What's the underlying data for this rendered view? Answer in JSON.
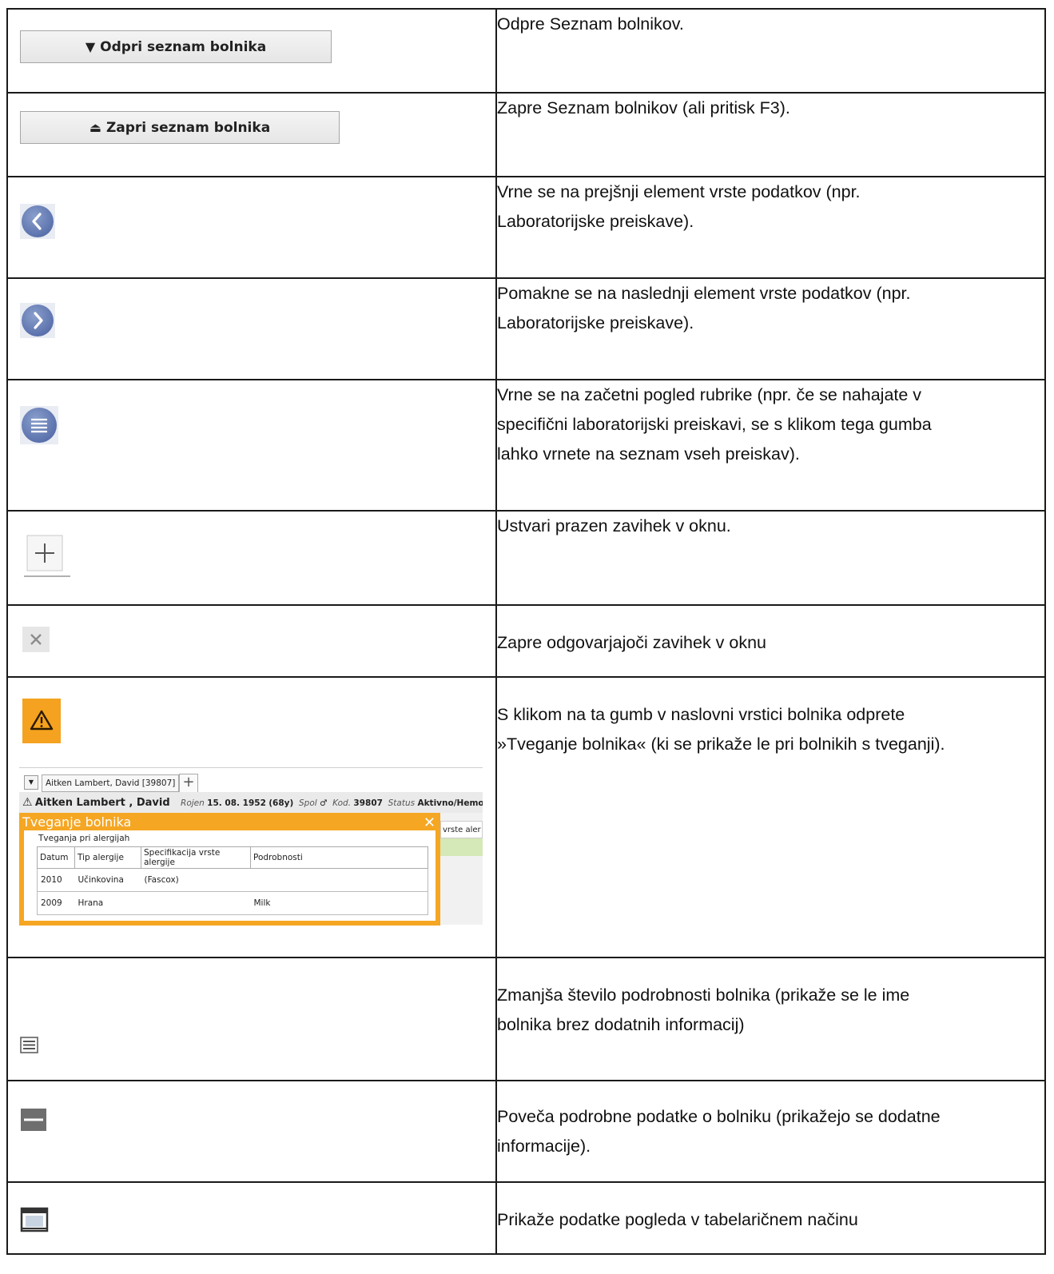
{
  "rows": [
    {
      "description": "Odpre Seznam bolnikov.",
      "button_label": "Odpri seznam bolnika",
      "icon": "triangle-down-icon"
    },
    {
      "description": "Zapre Seznam bolnikov (ali pritisk F3).",
      "button_label": "Zapri seznam bolnika",
      "icon": "eject-icon"
    },
    {
      "description_lines": [
        "Vrne se na prejšnji element vrste podatkov (npr.",
        "Laboratorijske preiskave)."
      ],
      "icon": "chevron-left-circle-icon"
    },
    {
      "description_lines": [
        "Pomakne se na naslednji element vrste podatkov (npr.",
        "Laboratorijske preiskave)."
      ],
      "icon": "chevron-right-circle-icon"
    },
    {
      "description_lines": [
        "Vrne se na začetni pogled rubrike (npr. če se nahajate v",
        "specifični laboratorijski preiskavi, se s klikom tega gumba",
        "lahko vrnete na seznam vseh preiskav)."
      ],
      "icon": "list-circle-icon"
    },
    {
      "description": "Ustvari prazen zavihek v oknu.",
      "icon": "plus-icon"
    },
    {
      "description": "Zapre odgovarjajoči zavihek v oknu",
      "icon": "close-icon"
    },
    {
      "description_lines": [
        "S klikom na ta gumb v naslovni vrstici bolnika odprete",
        "»Tveganje bolnika« (ki se prikaže le pri bolnikih s tveganji)."
      ],
      "icon": "warning-icon"
    },
    {
      "description_lines": [
        "Zmanjša število podrobnosti bolnika (prikaže se le ime",
        "bolnika brez dodatnih informacij)"
      ],
      "icon": "collapse-lines-icon"
    },
    {
      "description_lines": [
        "Poveča podrobne podatke o bolniku (prikažejo se dodatne",
        "informacije)."
      ],
      "icon": "minus-box-icon"
    },
    {
      "description": "Prikaže podatke pogleda v tabelaričnem načinu",
      "icon": "table-window-icon"
    }
  ],
  "screenshot": {
    "tab_label": "Aitken Lambert, David [39807]",
    "patient_name": "Aitken Lambert , David",
    "born_label": "Rojen",
    "born_value": "15. 08. 1952",
    "age": "(68y)",
    "sex_label": "Spol",
    "sex_symbol": "♂",
    "code_label": "Kod.",
    "code_value": "39807",
    "status_label": "Status",
    "status_value": "Aktivno/Hemodializa",
    "popup_title": "Tveganje bolnika",
    "section_title": "Tveganja pri alergijah",
    "columns": [
      "Datum",
      "Tip alergije",
      "Specifikacija vrste alergije",
      "Podrobnosti"
    ],
    "allergies": [
      {
        "date": "2010",
        "type": "Učinkovina",
        "spec": "(Fascox)",
        "details": ""
      },
      {
        "date": "2009",
        "type": "Hrana",
        "spec": "",
        "details": "Milk"
      }
    ],
    "background_header": "vrste aler"
  }
}
